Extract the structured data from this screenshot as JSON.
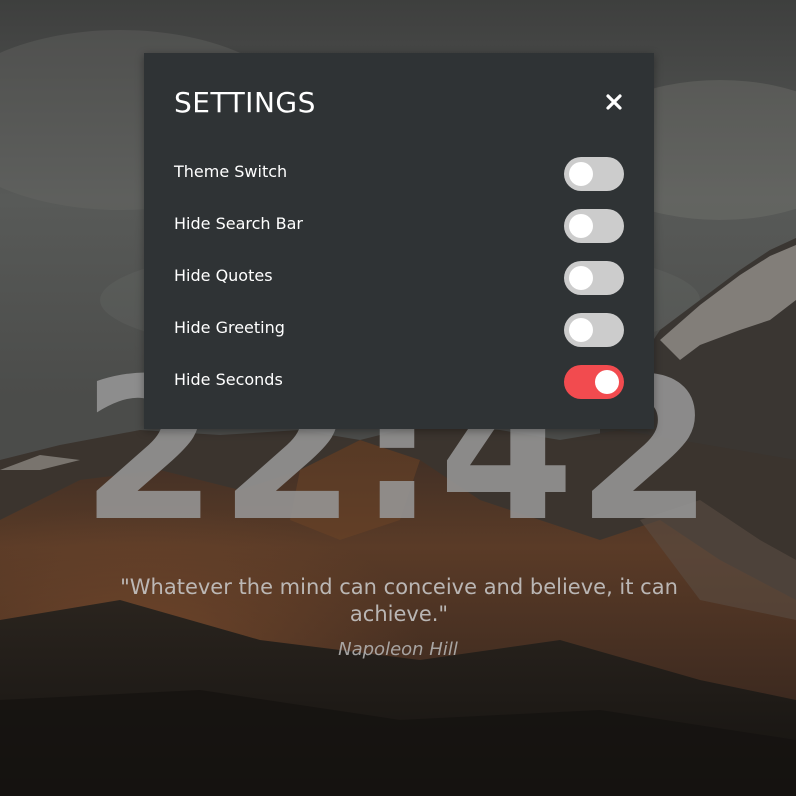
{
  "clock": {
    "time": "22:42"
  },
  "quote": {
    "text": "\"Whatever the mind can conceive and believe, it can achieve.\"",
    "author": "Napoleon Hill"
  },
  "settings": {
    "title": "SETTINGS",
    "close_icon": "close-icon",
    "accent_color": "#f24b4f",
    "items": [
      {
        "label": "Theme Switch",
        "enabled": false
      },
      {
        "label": "Hide Search Bar",
        "enabled": false
      },
      {
        "label": "Hide Quotes",
        "enabled": false
      },
      {
        "label": "Hide Greeting",
        "enabled": false
      },
      {
        "label": "Hide Seconds",
        "enabled": true
      }
    ]
  }
}
